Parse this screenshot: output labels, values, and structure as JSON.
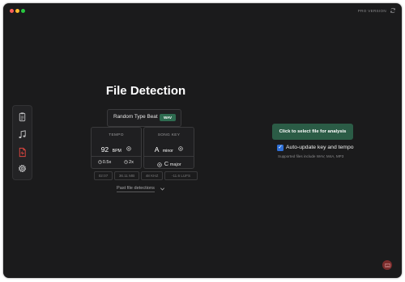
{
  "window": {
    "traffic_lights": [
      "close",
      "minimize",
      "zoom"
    ]
  },
  "header": {
    "pro_label": "PRO VERSION",
    "refresh_icon": "refresh-icon"
  },
  "sidebar": {
    "items": [
      {
        "icon": "clipboard-icon",
        "color": "#bfbfc1",
        "active": false
      },
      {
        "icon": "music-note-icon",
        "color": "#bfbfc1",
        "active": false
      },
      {
        "icon": "audio-file-icon",
        "color": "#e0463f",
        "active": true
      },
      {
        "icon": "gear-icon",
        "color": "#bfbfc1",
        "active": false
      }
    ]
  },
  "main": {
    "title": "File Detection",
    "file_name": "Random Type Beat",
    "file_format": "WAV",
    "tempo": {
      "label": "TEMPO",
      "value": "92",
      "unit": "BPM",
      "half_label": "0.5x",
      "double_label": "2x"
    },
    "key": {
      "label": "SONG KEY",
      "letter": "A",
      "mode": "minor",
      "relative_letter": "C",
      "relative_mode": "major"
    },
    "meta": {
      "duration": "02:07",
      "size": "36.11 MB",
      "rate": "48 KHZ",
      "loudness": "-11.6 LUFS"
    },
    "past_label": "Past file detections"
  },
  "panel": {
    "select_label": "Click to select file for analysis",
    "auto_update_label": "Auto-update key and tempo",
    "auto_update_checked": true,
    "supported_text": "Supported files include WAV, M4A, MP3"
  },
  "colors": {
    "accent_green": "#2b5c46",
    "accent_red": "#e0463f",
    "checkbox_blue": "#2f6fd6",
    "background": "#1b1b1c"
  }
}
